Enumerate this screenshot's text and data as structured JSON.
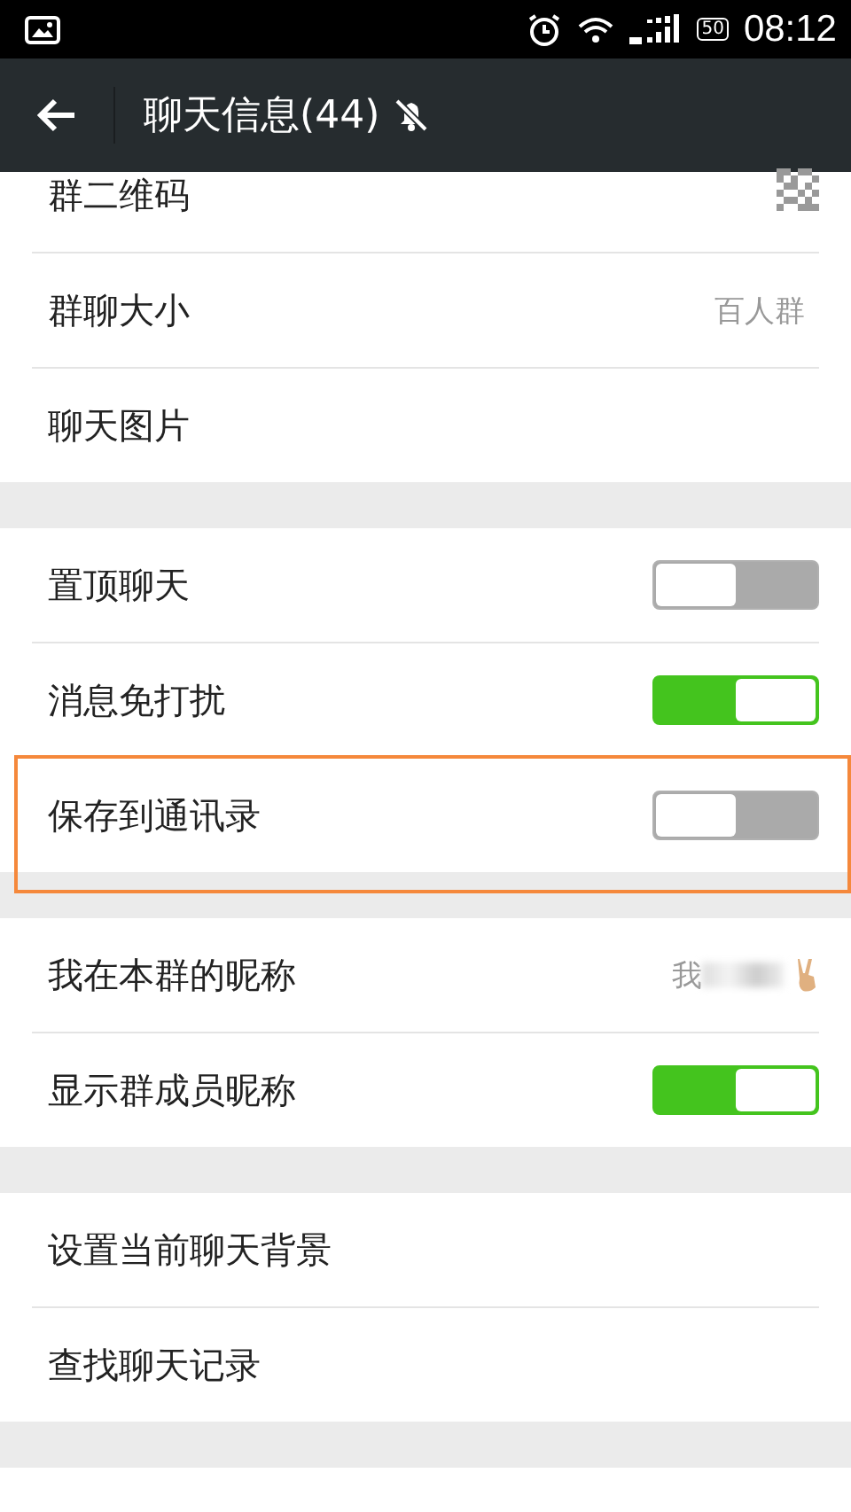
{
  "status_bar": {
    "battery": "50",
    "time": "08:12"
  },
  "header": {
    "title": "聊天信息(44)"
  },
  "sections": [
    {
      "rows": [
        {
          "kind": "qr",
          "label": "群二维码"
        },
        {
          "kind": "value",
          "label": "群聊大小",
          "value": "百人群"
        },
        {
          "kind": "plain",
          "label": "聊天图片"
        }
      ]
    },
    {
      "rows": [
        {
          "kind": "toggle",
          "label": "置顶聊天",
          "on": false
        },
        {
          "kind": "toggle",
          "label": "消息免打扰",
          "on": true
        },
        {
          "kind": "toggle",
          "label": "保存到通讯录",
          "on": false,
          "highlighted": true
        }
      ]
    },
    {
      "rows": [
        {
          "kind": "nickname",
          "label": "我在本群的昵称",
          "value": "我"
        },
        {
          "kind": "toggle",
          "label": "显示群成员昵称",
          "on": true
        }
      ]
    },
    {
      "rows": [
        {
          "kind": "plain",
          "label": "设置当前聊天背景"
        },
        {
          "kind": "plain",
          "label": "查找聊天记录"
        }
      ]
    }
  ]
}
